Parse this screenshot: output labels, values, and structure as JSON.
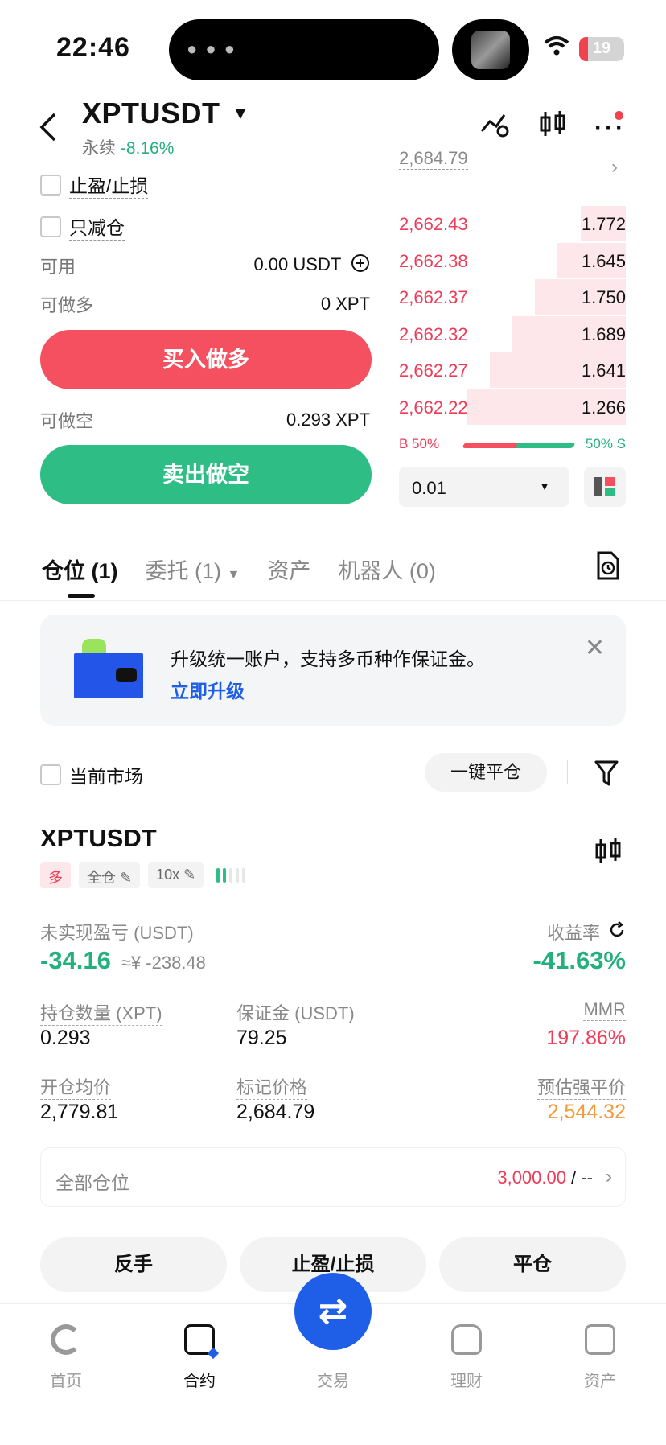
{
  "status": {
    "time": "22:46",
    "battery": "19"
  },
  "header": {
    "title": "XPTUSDT",
    "sub_type": "永续",
    "change": "-8.16%"
  },
  "form": {
    "tpsl_label": "止盈/止损",
    "reduce_label": "只减仓",
    "available_label": "可用",
    "available_value": "0.00 USDT",
    "long_label": "可做多",
    "long_value": "0 XPT",
    "buy_button": "买入做多",
    "short_label": "可做空",
    "short_value": "0.293 XPT",
    "sell_button": "卖出做空"
  },
  "orderbook": {
    "top_price": "2,684.79",
    "rows": [
      {
        "price": "2,662.43",
        "qty": "1.772",
        "depth": 0.2
      },
      {
        "price": "2,662.38",
        "qty": "1.645",
        "depth": 0.3
      },
      {
        "price": "2,662.37",
        "qty": "1.750",
        "depth": 0.4
      },
      {
        "price": "2,662.32",
        "qty": "1.689",
        "depth": 0.5
      },
      {
        "price": "2,662.27",
        "qty": "1.641",
        "depth": 0.6
      },
      {
        "price": "2,662.22",
        "qty": "1.266",
        "depth": 0.7
      }
    ],
    "buy_ratio": "B 50%",
    "sell_ratio": "50% S",
    "precision": "0.01"
  },
  "tabs": {
    "positions": "仓位 (1)",
    "orders": "委托 (1)",
    "assets": "资产",
    "bots": "机器人 (0)"
  },
  "banner": {
    "text": "升级统一账户，支持多币种作保证金。",
    "link": "立即升级"
  },
  "filters": {
    "current_market": "当前市场",
    "close_all": "一键平仓"
  },
  "position": {
    "symbol": "XPTUSDT",
    "side_tag": "多",
    "margin_tag": "全仓",
    "leverage_tag": "10x",
    "pnl_label": "未实现盈亏 (USDT)",
    "pnl_value": "-34.16",
    "pnl_cny": "≈¥ -238.48",
    "roe_label": "收益率",
    "roe_value": "-41.63%",
    "size_label": "持仓数量 (XPT)",
    "size_value": "0.293",
    "margin_label": "保证金 (USDT)",
    "margin_value": "79.25",
    "mmr_label": "MMR",
    "mmr_value": "197.86%",
    "entry_label": "开仓均价",
    "entry_value": "2,779.81",
    "mark_label": "标记价格",
    "mark_value": "2,684.79",
    "liq_label": "预估强平价",
    "liq_value": "2,544.32",
    "all_label": "全部仓位",
    "all_value": "3,000.00",
    "all_sep": "/ --"
  },
  "actions": {
    "reverse": "反手",
    "tpsl": "止盈/止损",
    "close": "平仓"
  },
  "nav": {
    "home": "首页",
    "contract": "合约",
    "trade": "交易",
    "finance": "理财",
    "assets": "资产"
  },
  "colors": {
    "red": "#ee3b58",
    "green": "#23b07d",
    "blue": "#1f5fe8",
    "orange": "#f49a3c"
  }
}
